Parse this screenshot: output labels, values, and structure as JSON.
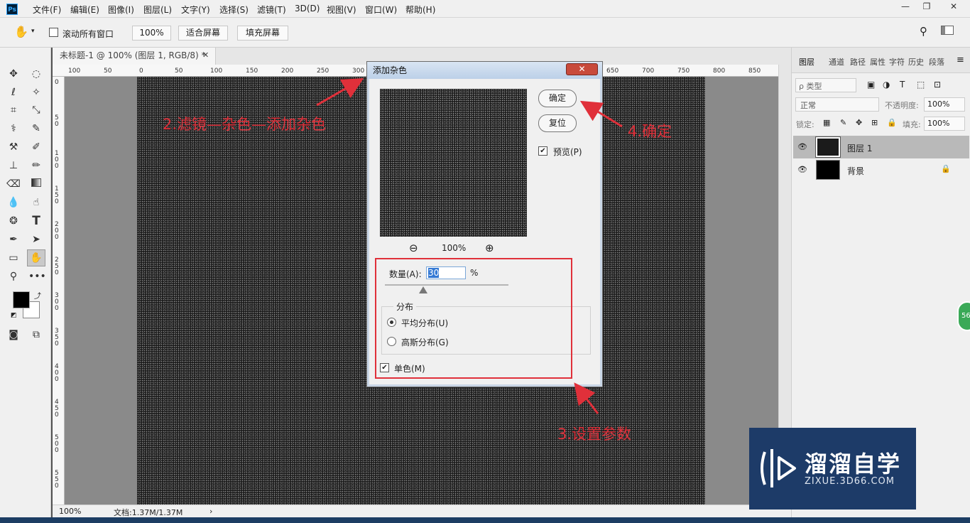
{
  "menubar": {
    "logo": "Ps",
    "items": [
      "文件(F)",
      "编辑(E)",
      "图像(I)",
      "图层(L)",
      "文字(Y)",
      "选择(S)",
      "滤镜(T)",
      "3D(D)",
      "视图(V)",
      "窗口(W)",
      "帮助(H)"
    ],
    "window_buttons": [
      "—",
      "❐",
      "✕"
    ]
  },
  "options": {
    "scroll_all": "滚动所有窗口",
    "zoom_value": "100%",
    "fit_screen": "适合屏幕",
    "fill_screen": "填充屏幕"
  },
  "document": {
    "tab_title": "未标题-1 @ 100% (图层 1, RGB/8) *",
    "status_zoom": "100%",
    "status_doc": "文档:1.37M/1.37M"
  },
  "ruler": {
    "h_labels": [
      "100",
      "50",
      "0",
      "50",
      "100",
      "150",
      "200",
      "250",
      "300",
      "650",
      "700",
      "750",
      "800",
      "850"
    ],
    "v_labels": [
      "0",
      "5\n0",
      "1\n0\n0",
      "1\n5\n0",
      "2\n0\n0",
      "2\n5\n0",
      "3\n0\n0",
      "3\n5\n0",
      "4\n0\n0",
      "4\n5\n0",
      "5\n0\n0",
      "5\n5\n0"
    ]
  },
  "layers_panel": {
    "tabs": [
      "图层",
      "通道",
      "路径",
      "属性",
      "字符",
      "历史",
      "段落"
    ],
    "filter_kind": "ρ 类型",
    "blend_mode": "正常",
    "opacity_label": "不透明度:",
    "opacity_value": "100%",
    "lock_label": "锁定:",
    "fill_label": "填充:",
    "fill_value": "100%",
    "layers": [
      {
        "name": "图层 1",
        "selected": true
      },
      {
        "name": "背景",
        "selected": false
      }
    ]
  },
  "dialog": {
    "title": "添加杂色",
    "close": "✕",
    "ok": "确定",
    "reset": "复位",
    "preview_label": "预览(P)",
    "zoom_out": "⊖",
    "zoom_level": "100%",
    "zoom_in": "⊕",
    "amount_label": "数量(A):",
    "amount_value": "30",
    "amount_unit": "%",
    "amount_slider_fraction": 0.31,
    "distribution_title": "分布",
    "uniform": "平均分布(U)",
    "gaussian": "高斯分布(G)",
    "distribution_selected": "uniform",
    "monochromatic": "单色(M)",
    "monochromatic_checked": true,
    "preview_checked": true
  },
  "annotations": {
    "step2": "2.滤镜—杂色—添加杂色",
    "step3": "3.设置参数",
    "step4": "4.确定",
    "color": "#e0303a"
  },
  "watermark": {
    "title": "溜溜自学",
    "url": "ZIXUE.3D66.COM"
  },
  "side_badge": "56"
}
